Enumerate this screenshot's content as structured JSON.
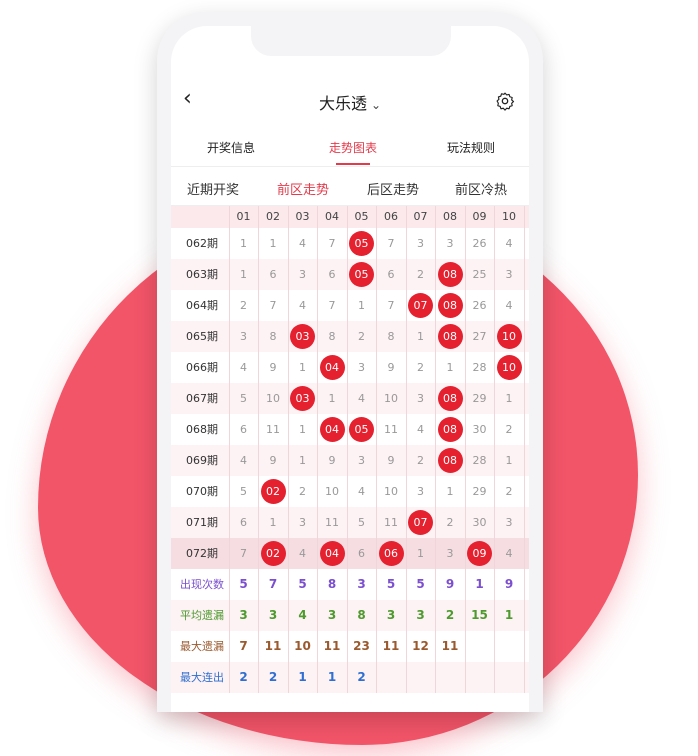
{
  "header": {
    "title": "大乐透",
    "back_icon": "chevron-left-icon",
    "settings_icon": "gear-icon"
  },
  "main_tabs": [
    {
      "label": "开奖信息",
      "active": false
    },
    {
      "label": "走势图表",
      "active": true
    },
    {
      "label": "玩法规则",
      "active": false
    }
  ],
  "sub_tabs": [
    {
      "label": "近期开奖",
      "active": false
    },
    {
      "label": "前区走势",
      "active": true
    },
    {
      "label": "后区走势",
      "active": false
    },
    {
      "label": "前区冷热",
      "active": false
    }
  ],
  "columns": [
    "01",
    "02",
    "03",
    "04",
    "05",
    "06",
    "07",
    "08",
    "09",
    "10"
  ],
  "rows": [
    {
      "period": "062期",
      "cells": [
        "1",
        "1",
        "4",
        "7",
        "05",
        "7",
        "3",
        "3",
        "26",
        "4"
      ],
      "hits": [
        4
      ]
    },
    {
      "period": "063期",
      "cells": [
        "1",
        "6",
        "3",
        "6",
        "05",
        "6",
        "2",
        "08",
        "25",
        "3"
      ],
      "hits": [
        4,
        7
      ]
    },
    {
      "period": "064期",
      "cells": [
        "2",
        "7",
        "4",
        "7",
        "1",
        "7",
        "07",
        "08",
        "26",
        "4"
      ],
      "hits": [
        6,
        7
      ]
    },
    {
      "period": "065期",
      "cells": [
        "3",
        "8",
        "03",
        "8",
        "2",
        "8",
        "1",
        "08",
        "27",
        "10"
      ],
      "hits": [
        2,
        7,
        9
      ]
    },
    {
      "period": "066期",
      "cells": [
        "4",
        "9",
        "1",
        "04",
        "3",
        "9",
        "2",
        "1",
        "28",
        "10"
      ],
      "hits": [
        3,
        9
      ]
    },
    {
      "period": "067期",
      "cells": [
        "5",
        "10",
        "03",
        "1",
        "4",
        "10",
        "3",
        "08",
        "29",
        "1"
      ],
      "hits": [
        2,
        7
      ]
    },
    {
      "period": "068期",
      "cells": [
        "6",
        "11",
        "1",
        "04",
        "05",
        "11",
        "4",
        "08",
        "30",
        "2"
      ],
      "hits": [
        3,
        4,
        7
      ]
    },
    {
      "period": "069期",
      "cells": [
        "4",
        "9",
        "1",
        "9",
        "3",
        "9",
        "2",
        "08",
        "28",
        "1"
      ],
      "hits": [
        7
      ]
    },
    {
      "period": "070期",
      "cells": [
        "5",
        "02",
        "2",
        "10",
        "4",
        "10",
        "3",
        "1",
        "29",
        "2"
      ],
      "hits": [
        1
      ]
    },
    {
      "period": "071期",
      "cells": [
        "6",
        "1",
        "3",
        "11",
        "5",
        "11",
        "07",
        "2",
        "30",
        "3"
      ],
      "hits": [
        6
      ]
    },
    {
      "period": "072期",
      "cells": [
        "7",
        "02",
        "4",
        "04",
        "6",
        "06",
        "1",
        "3",
        "09",
        "4"
      ],
      "hits": [
        1,
        3,
        5,
        8
      ]
    }
  ],
  "stats": [
    {
      "label": "出现次数",
      "color": "#7b4fcf",
      "values": [
        "5",
        "7",
        "5",
        "8",
        "3",
        "5",
        "5",
        "9",
        "1",
        "9"
      ]
    },
    {
      "label": "平均遗漏",
      "color": "#4e9a2e",
      "values": [
        "3",
        "3",
        "4",
        "3",
        "8",
        "3",
        "3",
        "2",
        "15",
        "1"
      ]
    },
    {
      "label": "最大遗漏",
      "color": "#9a5a2e",
      "values": [
        "7",
        "11",
        "10",
        "11",
        "23",
        "11",
        "12",
        "11",
        "",
        ""
      ]
    },
    {
      "label": "最大连出",
      "color": "#2f6fd1",
      "values": [
        "2",
        "2",
        "1",
        "1",
        "2",
        "",
        "",
        "",
        "",
        ""
      ]
    }
  ],
  "colors": {
    "accent": "#e33b4b",
    "ball": "#e5202f",
    "blob": "#f25468"
  }
}
